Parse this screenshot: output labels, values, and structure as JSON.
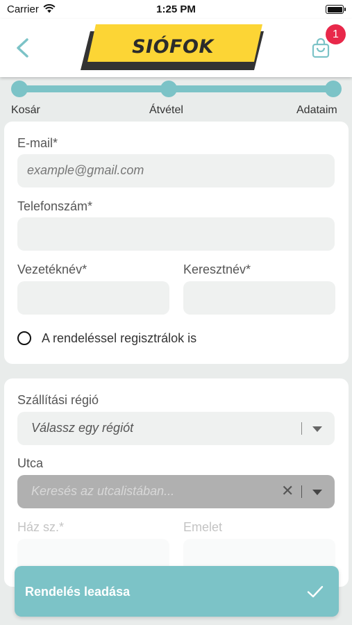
{
  "status_bar": {
    "carrier": "Carrier",
    "time": "1:25 PM"
  },
  "header": {
    "logo_text": "SIÓFOK",
    "cart_badge_count": "1",
    "colors": {
      "logo_yellow": "#fcd535",
      "logo_shadow": "#333333",
      "accent": "#7cc3c7",
      "badge": "#e8284a"
    }
  },
  "progress": {
    "steps": [
      "Kosár",
      "Átvétel",
      "Adataim"
    ]
  },
  "contact_form": {
    "email_label": "E-mail*",
    "email_placeholder": "example@gmail.com",
    "phone_label": "Telefonszám*",
    "lastname_label": "Vezetéknév*",
    "firstname_label": "Keresztnév*",
    "register_label": "A rendeléssel regisztrálok is"
  },
  "shipping_form": {
    "region_label": "Szállítási régió",
    "region_placeholder": "Válassz egy régiót",
    "street_label": "Utca",
    "street_placeholder": "Keresés az utcalistában...",
    "house_label": "Ház sz.*",
    "floor_label": "Emelet"
  },
  "submit": {
    "label": "Rendelés leadása"
  }
}
